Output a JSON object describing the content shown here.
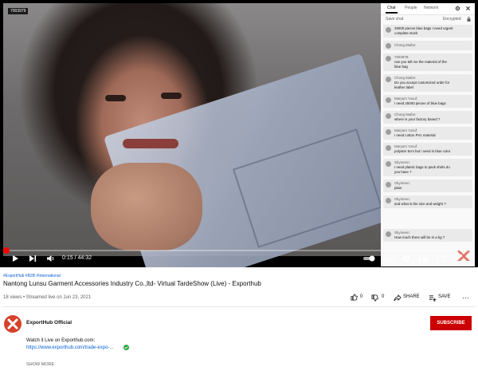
{
  "video": {
    "tag": "7003979",
    "progress": 0.006,
    "time": "0:15 / 44:32"
  },
  "chat": {
    "tabs": [
      "Chat",
      "People",
      "Network"
    ],
    "save_label": "Save chat",
    "encrypted_label": "Encrypted",
    "messages": [
      {
        "name": "",
        "lines": [
          "25000 pieces blue bags I need urgent",
          "complete stock"
        ]
      },
      {
        "name": "Chong Maibe:",
        "lines": []
      },
      {
        "name": "7003978:",
        "lines": [
          "can you tell me the material of the",
          "blue bag"
        ]
      },
      {
        "name": "Chong Maibe:",
        "lines": [
          "Do you accept customized order for",
          "leather label"
        ]
      },
      {
        "name": "Maryam Yusuf:",
        "lines": [
          "I need 25000 pieces of blue bags"
        ]
      },
      {
        "name": "Chong Maibe:",
        "lines": [
          "where is your factory based ?"
        ]
      },
      {
        "name": "Maryam Yusuf:",
        "lines": [
          "I need cotton PVc material"
        ]
      },
      {
        "name": "Maryam Yusuf:",
        "lines": [
          "polyster 5cm but i need in blue color"
        ]
      },
      {
        "name": "Shymeen:",
        "lines": [
          "I need plastic bags to pack shirts do",
          "you have ?"
        ]
      },
      {
        "name": "Shymeen:",
        "lines": [
          "plain"
        ]
      },
      {
        "name": "Shymeen:",
        "lines": [
          "and what is the size and weight ?"
        ]
      },
      {
        "name": "Shymeen:",
        "lines": [
          "How much there will be in a kg ?"
        ]
      }
    ]
  },
  "info": {
    "hashtags": "#ExportHub #B2B #International",
    "title": "Nantong Lunsu Garment Accessories Industry Co.,ltd- Virtual TardeShow (Live) - Exporthub",
    "meta": "18 views • Streamed live on Jun 23, 2021",
    "likes": "0",
    "dislikes": "0",
    "share_label": "SHARE",
    "save_label": "SAVE",
    "more": "…"
  },
  "channel": {
    "name": "ExportHub Official",
    "subscribe_label": "SUBSCRIBE",
    "desc_line1": "Watch it Live on Exporthub.com:",
    "desc_link": "https://www.exporthub.com/trade-expo-...",
    "show_more": "SHOW MORE"
  },
  "colors": {
    "accent_red": "#cc0000",
    "link_blue": "#065fd4",
    "brand_orange": "#d7412b"
  }
}
